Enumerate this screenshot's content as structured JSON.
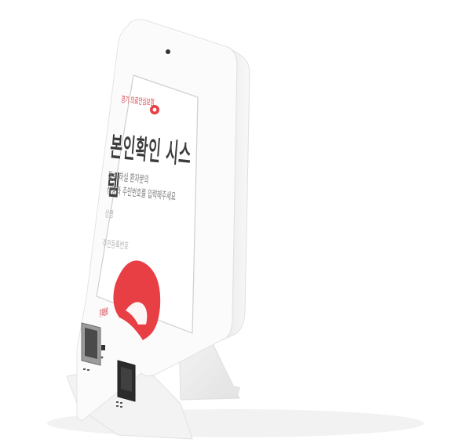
{
  "screen": {
    "brand_label": "경기 의료안심보험",
    "title": "본인확인 시스템",
    "instruction_line1": "접수 하실 환자분의",
    "instruction_line2": "성명과 주민번호를 입력해주세요",
    "name_label": "성명",
    "id_label": "주민등록번호"
  },
  "kiosk_body": {
    "brand_label": "경기 의료안심보험"
  },
  "colors": {
    "accent_red": "#e83f45",
    "kiosk_white": "#f7f7f7",
    "shadow": "#d9d9d9"
  }
}
